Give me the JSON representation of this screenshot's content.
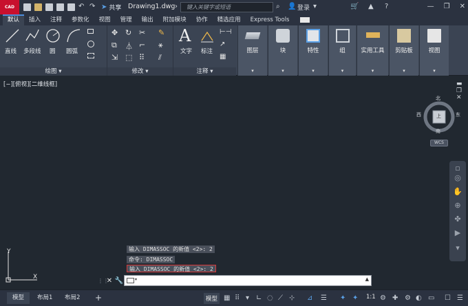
{
  "app": {
    "logo_text": "CAD",
    "doc_title": "Drawing1.dwg",
    "search_placeholder": "键入关键字或短语",
    "share_label": "共享",
    "login_label": "登录",
    "help_icon": "help-icon"
  },
  "tabs": [
    "默认",
    "插入",
    "注释",
    "参数化",
    "视图",
    "管理",
    "输出",
    "附加模块",
    "协作",
    "精选应用",
    "Express Tools"
  ],
  "ribbon": {
    "draw": {
      "title": "绘图",
      "line": "直线",
      "polyline": "多段线",
      "circle": "圆",
      "arc": "圆弧"
    },
    "modify": {
      "title": "修改"
    },
    "annotation": {
      "title": "注释",
      "text": "文字",
      "dimension": "标注"
    },
    "tiles": [
      "图层",
      "块",
      "特性",
      "组",
      "实用工具",
      "剪贴板",
      "视图"
    ]
  },
  "viewport": {
    "label": "[−][俯视][二维线框]",
    "viewcube": {
      "north": "北",
      "south": "南",
      "east": "东",
      "west": "西",
      "face": "上"
    },
    "wcs": "WCS",
    "ucs_x": "X",
    "ucs_y": "Y"
  },
  "command": {
    "history": [
      "输入 DIMASSOC 的新值 <2>: 2",
      "命令: DIMASSOC",
      "输入 DIMASSOC 的新值 <2>: 2"
    ],
    "input_value": ""
  },
  "status": {
    "layout_tabs": [
      "模型",
      "布局1",
      "布局2"
    ],
    "add_tab": "+",
    "model_label": "模型",
    "scale": "1:1"
  },
  "colors": {
    "accent": "#4c8ddc",
    "bg": "#212830",
    "ribbon": "#3b4453",
    "highlight": "#d93a3a"
  }
}
